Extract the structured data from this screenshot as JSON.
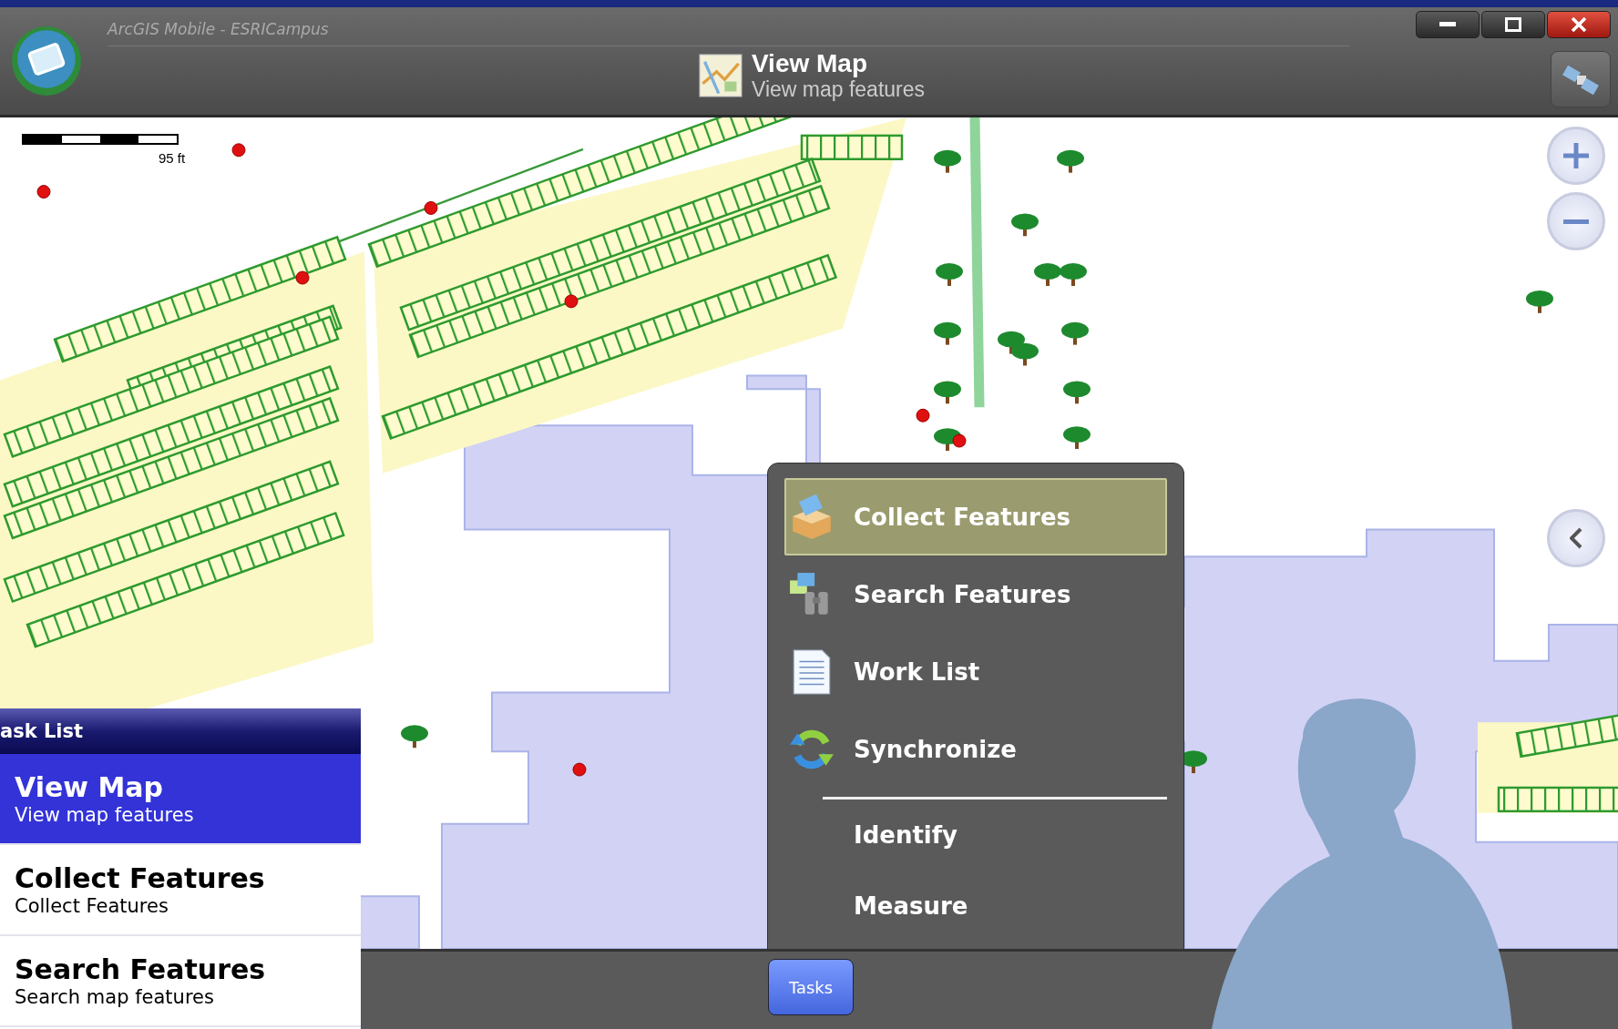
{
  "window": {
    "title": "ArcGIS Mobile - ESRICampus"
  },
  "header": {
    "title": "View Map",
    "subtitle": "View map features"
  },
  "map": {
    "scale_label": "95 ft"
  },
  "task_menu": {
    "items": [
      {
        "label": "Collect Features",
        "selected": true
      },
      {
        "label": "Search Features",
        "selected": false
      },
      {
        "label": "Work List",
        "selected": false
      },
      {
        "label": "Synchronize",
        "selected": false
      }
    ],
    "tools": [
      {
        "label": "Identify"
      },
      {
        "label": "Measure"
      }
    ]
  },
  "bottom_bar": {
    "button": "Tasks"
  },
  "task_list": {
    "title": "ask List",
    "items": [
      {
        "title": "View Map",
        "subtitle": "View map features",
        "selected": true
      },
      {
        "title": "Collect Features",
        "subtitle": "Collect Features",
        "selected": false
      },
      {
        "title": "Search Features",
        "subtitle": "Search map features",
        "selected": false
      }
    ]
  }
}
